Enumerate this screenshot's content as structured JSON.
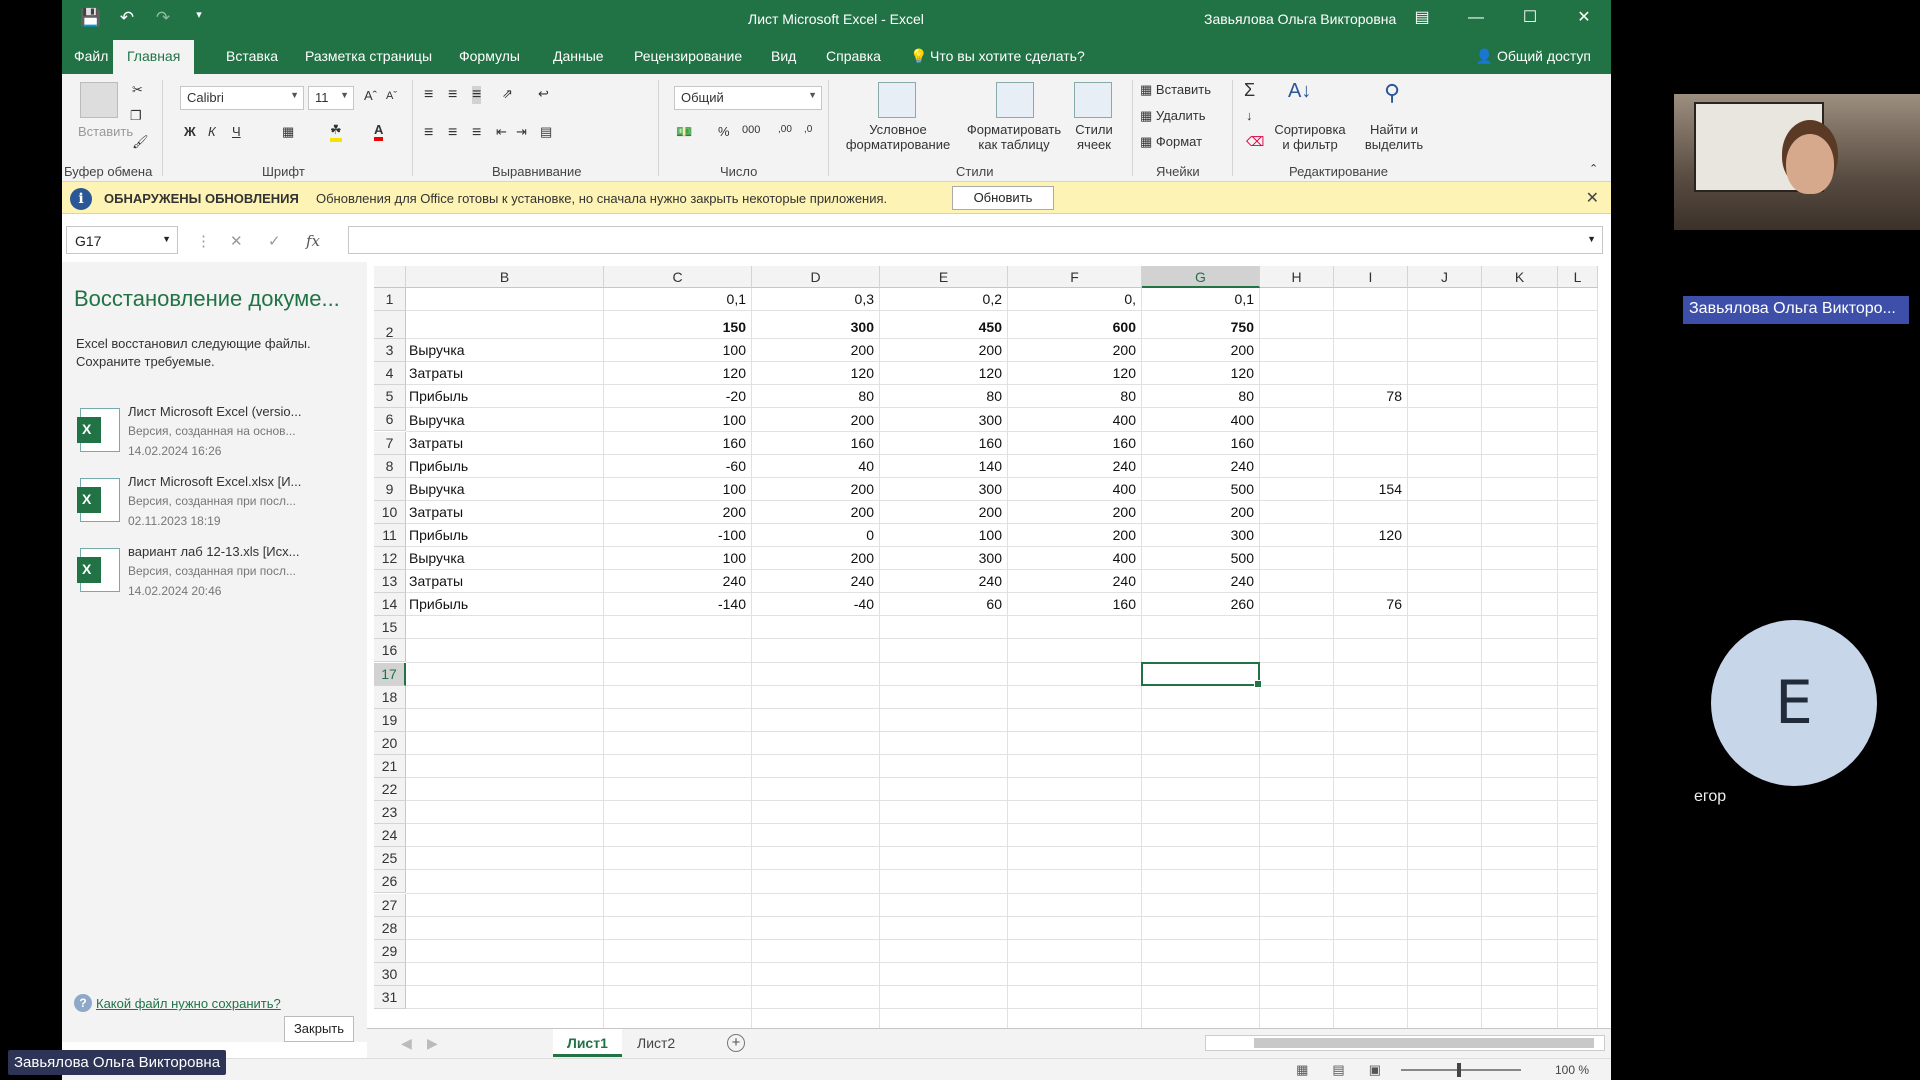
{
  "titlebar": {
    "title": "Лист Microsoft Excel  -  Excel",
    "user": "Завьялова Ольга Викторовна"
  },
  "ribbon_tabs": [
    "Файл",
    "Главная",
    "Вставка",
    "Разметка страницы",
    "Формулы",
    "Данные",
    "Рецензирование",
    "Вид",
    "Справка"
  ],
  "tell_me": "Что вы хотите сделать?",
  "share": "Общий доступ",
  "ribbon": {
    "paste": "Вставить",
    "font_name": "Calibri",
    "font_size": "11",
    "number_format": "Общий",
    "conditional_formatting": [
      "Условное",
      "форматирование"
    ],
    "format_as_table": [
      "Форматировать",
      "как таблицу"
    ],
    "cell_styles": [
      "Стили",
      "ячеек"
    ],
    "insert": "Вставить",
    "delete": "Удалить",
    "format": "Формат",
    "sort_filter": [
      "Сортировка",
      "и фильтр"
    ],
    "find_select": [
      "Найти и",
      "выделить"
    ],
    "groups": [
      "Буфер обмена",
      "Шрифт",
      "Выравнивание",
      "Число",
      "Стили",
      "Ячейки",
      "Редактирование"
    ]
  },
  "infobar": {
    "title": "ОБНАРУЖЕНЫ ОБНОВЛЕНИЯ",
    "message": "Обновления для Office готовы к установке, но сначала нужно закрыть некоторые приложения.",
    "button": "Обновить"
  },
  "namebox": "G17",
  "recovery": {
    "title": "Восстановление докуме...",
    "description": "Excel восстановил следующие файлы. Сохраните требуемые.",
    "files": [
      {
        "name": "Лист Microsoft Excel (versio...",
        "version": "Версия, созданная на основ...",
        "date": "14.02.2024 16:26"
      },
      {
        "name": "Лист Microsoft Excel.xlsx  [И...",
        "version": "Версия, созданная при посл...",
        "date": "02.11.2023 18:19"
      },
      {
        "name": "вариант лаб 12-13.xls  [Исх...",
        "version": "Версия, созданная при посл...",
        "date": "14.02.2024 20:46"
      }
    ],
    "help_link": "Какой файл нужно сохранить?",
    "close": "Закрыть"
  },
  "grid": {
    "columns": [
      "B",
      "C",
      "D",
      "E",
      "F",
      "G",
      "H",
      "I",
      "J",
      "K",
      "L"
    ],
    "selected_column": "G",
    "selected_row": 17,
    "rows": [
      {
        "r": 1,
        "cells": {
          "C": "0,1",
          "D": "0,3",
          "E": "0,2",
          "F": "0,",
          "G": "0,1"
        }
      },
      {
        "r": 2,
        "cells": {
          "C": "150",
          "D": "300",
          "E": "450",
          "F": "600",
          "G": "750"
        },
        "bold": true
      },
      {
        "r": 3,
        "cells": {
          "B": "Выручка",
          "C": "100",
          "D": "200",
          "E": "200",
          "F": "200",
          "G": "200"
        }
      },
      {
        "r": 4,
        "cells": {
          "B": "Затраты",
          "C": "120",
          "D": "120",
          "E": "120",
          "F": "120",
          "G": "120"
        }
      },
      {
        "r": 5,
        "cells": {
          "B": "Прибыль",
          "C": "-20",
          "D": "80",
          "E": "80",
          "F": "80",
          "G": "80",
          "I": "78"
        }
      },
      {
        "r": 6,
        "cells": {
          "B": "Выручка",
          "C": "100",
          "D": "200",
          "E": "300",
          "F": "400",
          "G": "400"
        }
      },
      {
        "r": 7,
        "cells": {
          "B": "Затраты",
          "C": "160",
          "D": "160",
          "E": "160",
          "F": "160",
          "G": "160"
        }
      },
      {
        "r": 8,
        "cells": {
          "B": "Прибыль",
          "C": "-60",
          "D": "40",
          "E": "140",
          "F": "240",
          "G": "240"
        }
      },
      {
        "r": 9,
        "cells": {
          "B": "Выручка",
          "C": "100",
          "D": "200",
          "E": "300",
          "F": "400",
          "G": "500",
          "I": "154"
        }
      },
      {
        "r": 10,
        "cells": {
          "B": "Затраты",
          "C": "200",
          "D": "200",
          "E": "200",
          "F": "200",
          "G": "200"
        }
      },
      {
        "r": 11,
        "cells": {
          "B": "Прибыль",
          "C": "-100",
          "D": "0",
          "E": "100",
          "F": "200",
          "G": "300",
          "I": "120"
        }
      },
      {
        "r": 12,
        "cells": {
          "B": "Выручка",
          "C": "100",
          "D": "200",
          "E": "300",
          "F": "400",
          "G": "500"
        }
      },
      {
        "r": 13,
        "cells": {
          "B": "Затраты",
          "C": "240",
          "D": "240",
          "E": "240",
          "F": "240",
          "G": "240"
        }
      },
      {
        "r": 14,
        "cells": {
          "B": "Прибыль",
          "C": "-140",
          "D": "-40",
          "E": "60",
          "F": "160",
          "G": "260",
          "I": "76"
        }
      }
    ]
  },
  "sheets": [
    "Лист1",
    "Лист2"
  ],
  "active_sheet": "Лист1",
  "zoom": "100 %",
  "meeting": {
    "presenter_label": "Завьялова Ольга Викторовна",
    "video_label": "Завьялова Ольга Викторо...",
    "avatar_initial": "Е",
    "avatar_name": "егор"
  },
  "colors": {
    "excel_green": "#217346",
    "infobar": "#fdf3b4",
    "video_label": "#3d4fa8",
    "avatar": "#c8d6ea"
  }
}
